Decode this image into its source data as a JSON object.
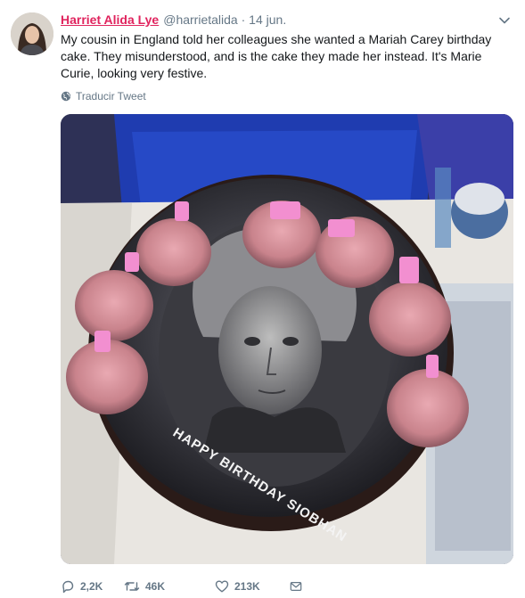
{
  "tweet": {
    "author_name": "Harriet Alida Lye",
    "author_handle": "@harrietalida",
    "separator": "·",
    "date": "14 jun.",
    "text": "My cousin in England told her colleagues she wanted a Mariah Carey birthday cake. They misunderstood, and is the cake they made her instead. It's Marie Curie, looking very festive.",
    "translate_label": "Traducir Tweet",
    "cake_inscription": "HAPPY BIRTHDAY SIOBHAN"
  },
  "actions": {
    "replies": "2,2K",
    "retweets": "46K",
    "likes": "213K"
  },
  "colors": {
    "name": "#e0245e",
    "muted": "#657786",
    "text": "#14171a"
  },
  "icons": {
    "caret": "chevron-down-icon",
    "translate": "globe-icon",
    "reply": "reply-icon",
    "retweet": "retweet-icon",
    "like": "heart-icon",
    "dm": "envelope-icon"
  }
}
